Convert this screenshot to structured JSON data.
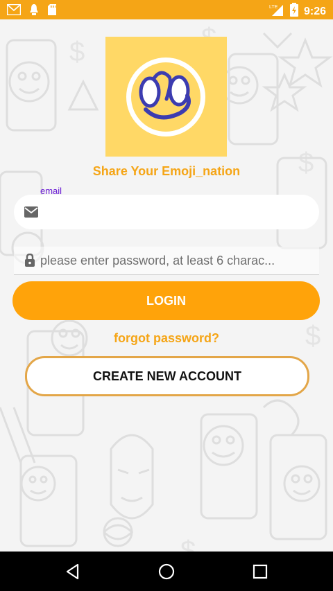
{
  "status_bar": {
    "time": "9:26",
    "network": "LTE",
    "icons": [
      "gmail-icon",
      "notification-icon",
      "sd-card-icon",
      "lte-signal-icon",
      "battery-icon"
    ]
  },
  "app": {
    "tagline": "Share Your Emoji_nation"
  },
  "form": {
    "email_label": "email",
    "email_value": "",
    "password_placeholder": "please enter password, at least 6 charac...",
    "login_label": "LOGIN",
    "forgot_label": "forgot password?",
    "create_label": "CREATE NEW ACCOUNT"
  },
  "navigation": {
    "buttons": [
      "back-icon",
      "home-icon",
      "recents-icon"
    ]
  },
  "colors": {
    "accent": "#f5a516",
    "button": "#ffa30a",
    "label": "#6a1bd4",
    "logo_bg": "#ffd866"
  }
}
